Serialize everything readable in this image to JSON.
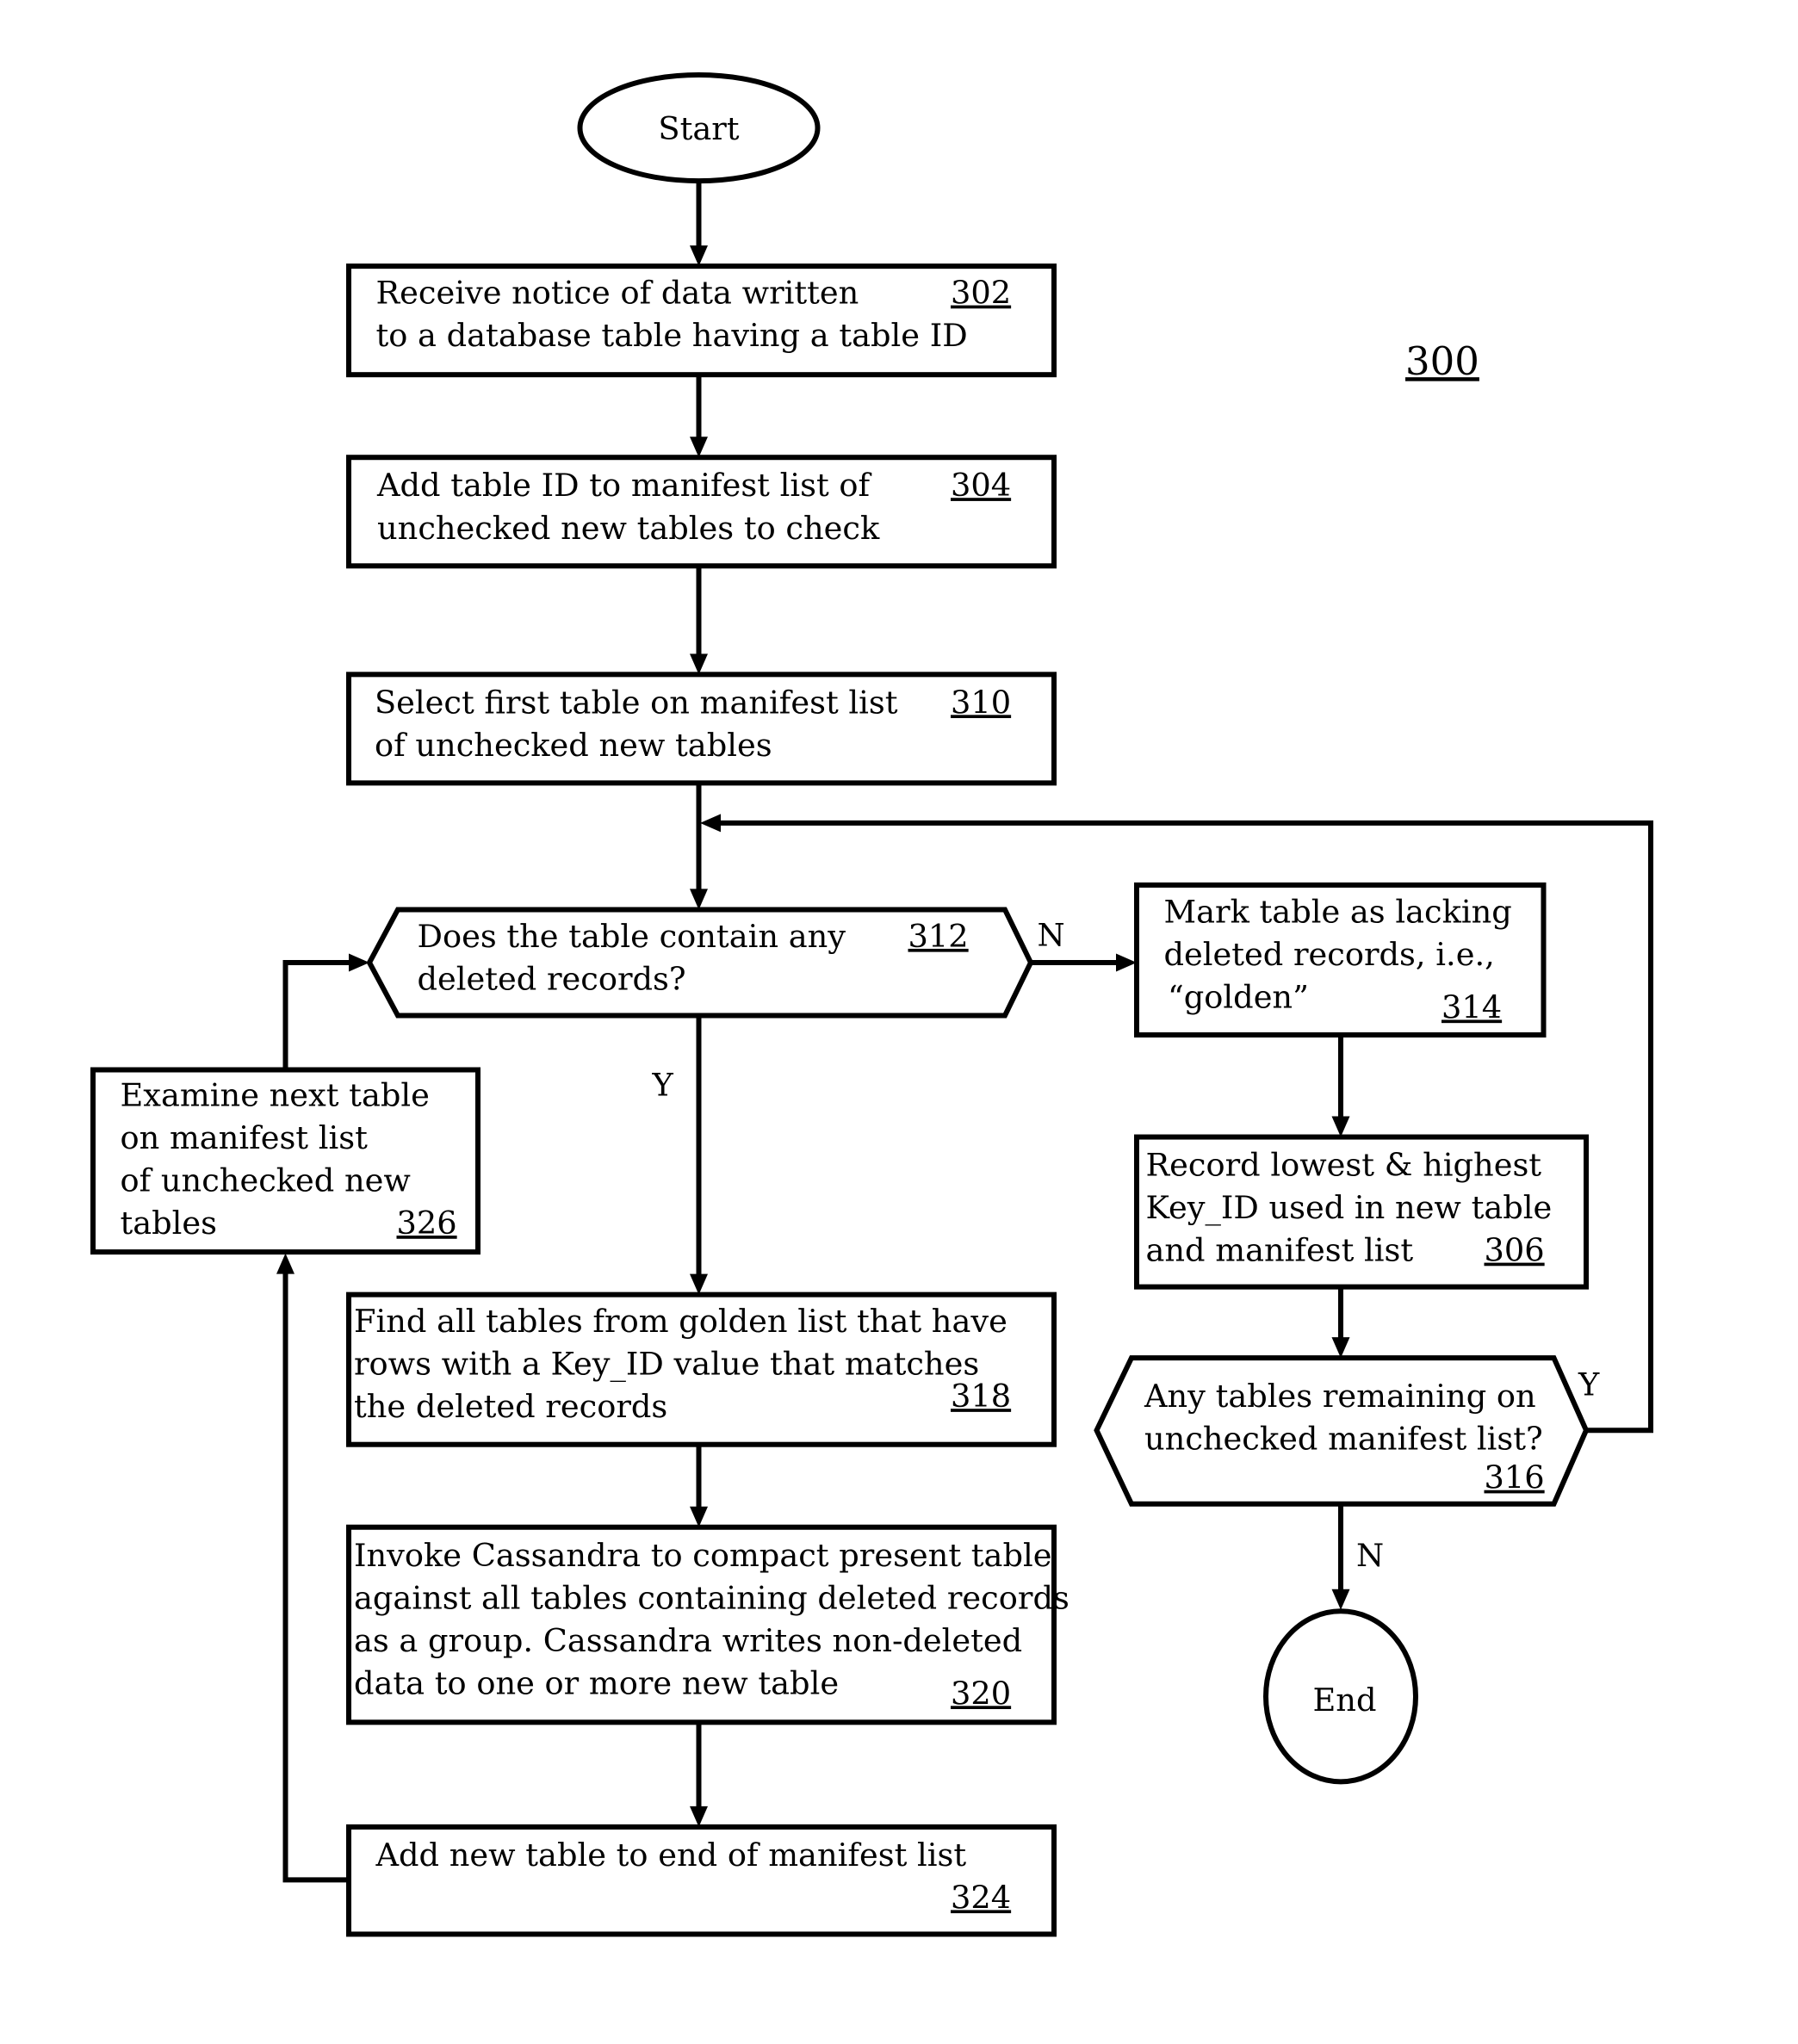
{
  "figure": {
    "reference": "300"
  },
  "nodes": {
    "start": {
      "label": "Start"
    },
    "end": {
      "label": "End"
    },
    "n302": {
      "ref": "302",
      "lines": [
        "Receive notice of data written",
        "to a database table having a table ID"
      ]
    },
    "n304": {
      "ref": "304",
      "lines": [
        "Add table ID to manifest list of",
        "unchecked new tables to check"
      ]
    },
    "n310": {
      "ref": "310",
      "lines": [
        "Select first table on manifest list",
        "of unchecked new tables"
      ]
    },
    "n312": {
      "ref": "312",
      "lines": [
        "Does the table contain any",
        "deleted records?"
      ]
    },
    "n314": {
      "ref": "314",
      "lines": [
        "Mark table as lacking",
        "deleted records, i.e.,",
        "“golden”"
      ]
    },
    "n306": {
      "ref": "306",
      "lines": [
        "Record lowest & highest",
        "Key_ID used in new table",
        "and manifest list"
      ]
    },
    "n316": {
      "ref": "316",
      "lines": [
        "Any tables remaining on",
        "unchecked manifest list?"
      ]
    },
    "n318": {
      "ref": "318",
      "lines": [
        "Find all tables from golden list that have",
        "rows with a Key_ID value that matches",
        "the deleted records"
      ]
    },
    "n320": {
      "ref": "320",
      "lines": [
        "Invoke Cassandra to compact present table",
        "against all tables containing deleted records",
        "as a group. Cassandra writes non-deleted",
        "data to one or more new table"
      ]
    },
    "n324": {
      "ref": "324",
      "lines": [
        "Add new table to end of manifest list"
      ]
    },
    "n326": {
      "ref": "326",
      "lines": [
        "Examine next table",
        "on manifest list",
        "of unchecked new",
        "tables"
      ]
    }
  },
  "branches": {
    "n312_no": "N",
    "n312_yes": "Y",
    "n316_yes": "Y",
    "n316_no": "N"
  }
}
